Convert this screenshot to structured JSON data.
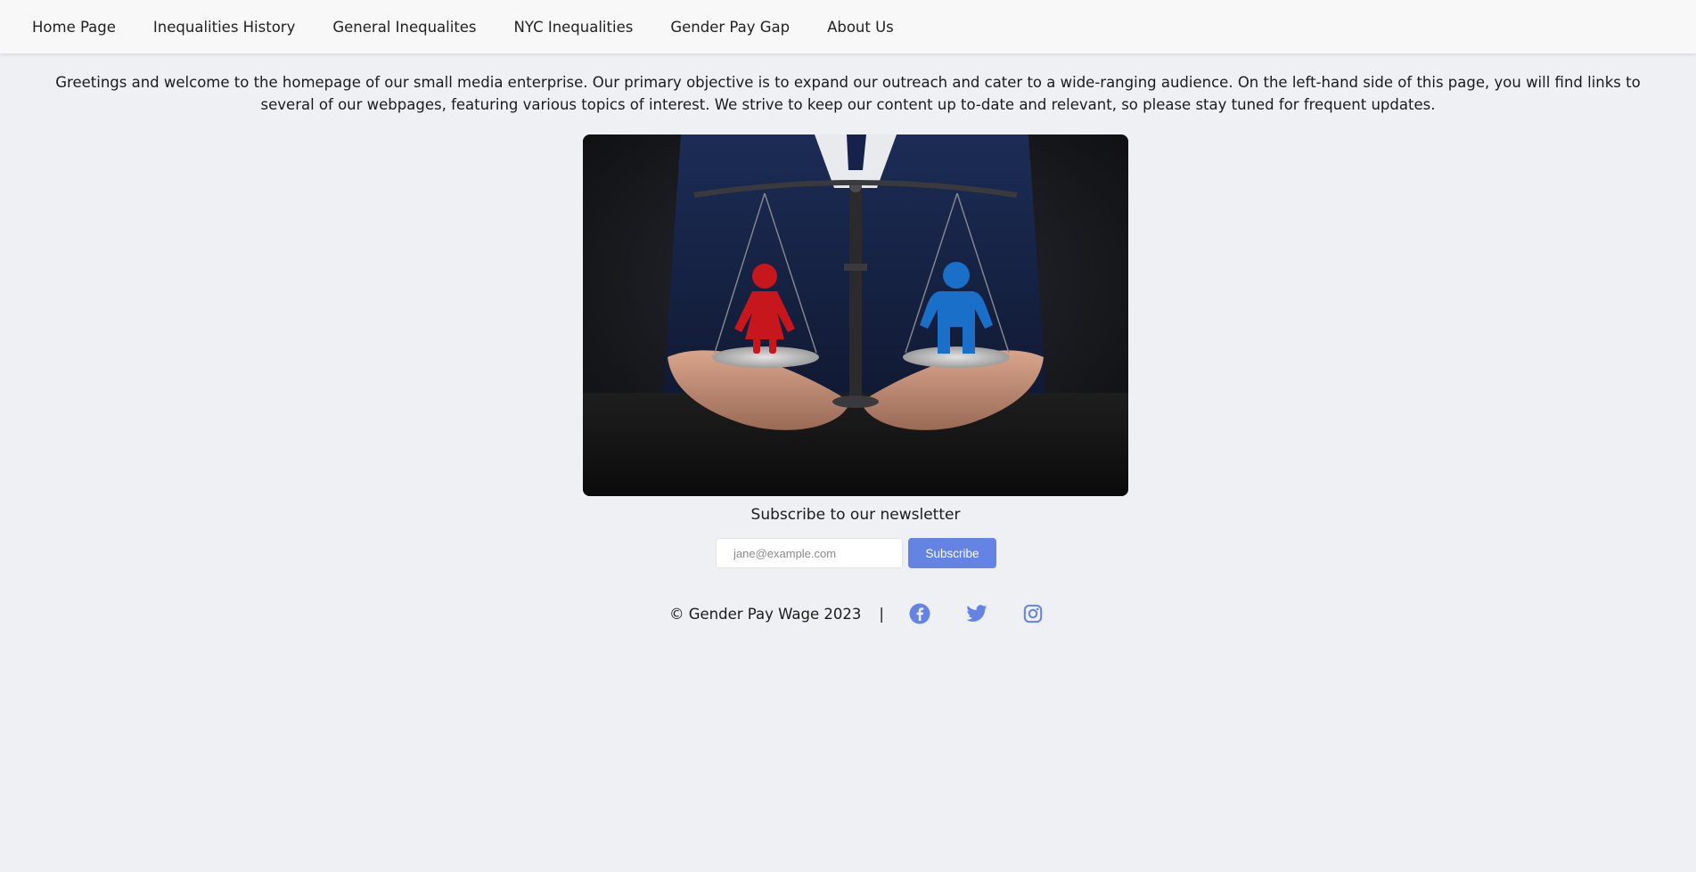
{
  "nav": {
    "items": [
      {
        "label": "Home Page"
      },
      {
        "label": "Inequalities History"
      },
      {
        "label": "General Inequalites"
      },
      {
        "label": "NYC Inequalities"
      },
      {
        "label": "Gender Pay Gap"
      },
      {
        "label": "About Us"
      }
    ]
  },
  "intro": {
    "text": "Greetings and welcome to the homepage of our small media enterprise. Our primary objective is to expand our outreach and cater to a wide-ranging audience. On the left-hand side of this page, you will find links to several of our webpages, featuring various topics of interest. We strive to keep our content up to-date and relevant, so please stay tuned for frequent updates."
  },
  "hero": {
    "image_icon": "scales-of-justice-gender-equality-image"
  },
  "newsletter": {
    "title": "Subscribe to our newsletter",
    "email_placeholder": "jane@example.com",
    "email_value": "",
    "button_label": "Subscribe"
  },
  "footer": {
    "copyright": "© Gender Pay Wage 2023",
    "separator": "|",
    "social": [
      {
        "icon": "facebook-icon"
      },
      {
        "icon": "twitter-icon"
      },
      {
        "icon": "instagram-icon"
      }
    ]
  },
  "colors": {
    "accent": "#6483e3",
    "background": "#eff0f4",
    "navbar": "#f8f8f9",
    "female_figure": "#c8161d",
    "male_figure": "#1a6fc9"
  }
}
